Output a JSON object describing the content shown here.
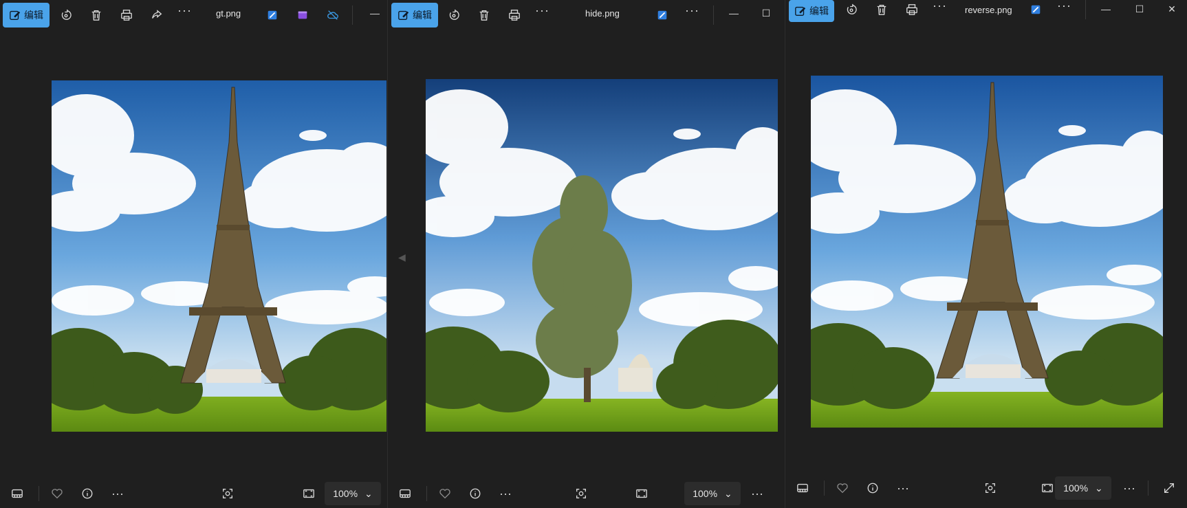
{
  "windows": [
    {
      "edit_label": "编辑",
      "filename": "gt.png",
      "zoom": "100%",
      "more": "···",
      "image": "eiffel"
    },
    {
      "edit_label": "编辑",
      "filename": "hide.png",
      "zoom": "100%",
      "more": "···",
      "image": "tree"
    },
    {
      "edit_label": "编辑",
      "filename": "reverse.png",
      "zoom": "100%",
      "more": "···",
      "image": "eiffel"
    }
  ],
  "colors": {
    "accent": "#4aa3ea",
    "background": "#1f1f1f"
  }
}
